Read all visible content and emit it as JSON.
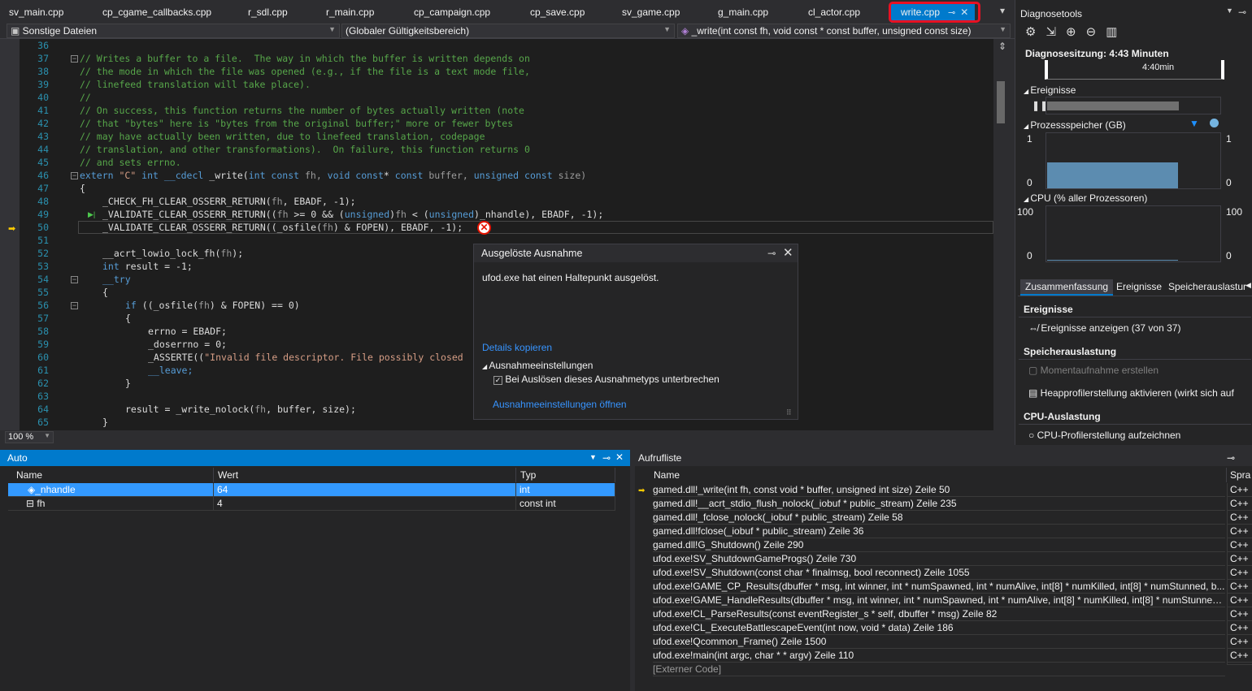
{
  "tabs": [
    "sv_main.cpp",
    "cp_cgame_callbacks.cpp",
    "r_sdl.cpp",
    "r_main.cpp",
    "cp_campaign.cpp",
    "cp_save.cpp",
    "sv_game.cpp",
    "g_main.cpp",
    "cl_actor.cpp"
  ],
  "active_tab": "write.cpp",
  "nav": {
    "project": "Sonstige Dateien",
    "scope": "(Globaler Gültigkeitsbereich)",
    "member": "_write(int const fh, void const * const buffer, unsigned const size)"
  },
  "zoom": "100 %",
  "code": {
    "lines": [
      "36",
      "37",
      "38",
      "39",
      "40",
      "41",
      "42",
      "43",
      "44",
      "45",
      "46",
      "47",
      "48",
      "49",
      "50",
      "51",
      "52",
      "53",
      "54",
      "55",
      "56",
      "57",
      "58",
      "59",
      "60",
      "61",
      "62",
      "63",
      "64",
      "65"
    ],
    "l37": "// Writes a buffer to a file.  The way in which the buffer is written depends on",
    "l38": "// the mode in which the file was opened (e.g., if the file is a text mode file,",
    "l39": "// linefeed translation will take place).",
    "l40": "//",
    "l41": "// On success, this function returns the number of bytes actually written (note",
    "l42": "// that \"bytes\" here is \"bytes from the original buffer;\" more or fewer bytes",
    "l43": "// may have actually been written, due to linefeed translation, codepage",
    "l44": "// translation, and other transformations).  On failure, this function returns 0",
    "l45": "// and sets errno.",
    "l46a": "extern",
    "l46b": " \"C\" ",
    "l46c": "int __cdecl",
    "l46d": " _write(",
    "l46e": "int const",
    " l46f": "",
    "l46g": " fh, ",
    "l46h": "void const",
    "l46i": "* ",
    "l46j": "const",
    "l46k": " buffer, ",
    "l46l": "unsigned const",
    "l46m": " size)",
    "l47": "{",
    "l48a": "_CHECK_FH_CLEAR_OSSERR_RETURN(",
    "l48b": "fh",
    ", l48c": "",
    "l48d": ", EBADF, -1);",
    "l49a": "_VALIDATE_CLEAR_OSSERR_RETURN((",
    "l49b": "fh",
    "l49c": " >= 0 && (",
    "l49d": "unsigned",
    "l49e": ")",
    "l49f": "fh",
    "l49g": " < (",
    "l49h": "unsigned",
    "l49i": ")_nhandle), EBADF, -1);",
    "l50a": "_VALIDATE_CLEAR_OSSERR_RETURN((_osfile(",
    "l50b": "fh",
    "l50c": ") & FOPEN), EBADF, -1);",
    "l52a": "__acrt_lowio_lock_fh(",
    "l52b": "fh",
    "l52c": ");",
    "l53a": "int",
    "l53b": " result = -1;",
    "l54": "__try",
    "l55": "{",
    "l56a": "if",
    "l56b": " ((_osfile(",
    "l56c": "fh",
    "l56d": ") & FOPEN) == 0)",
    "l57": "{",
    "l58": "errno = EBADF;",
    "l59": "_doserrno = 0;",
    "l60a": "_ASSERTE((",
    "l60b": "\"Invalid file descriptor. File possibly closed",
    "l61": "__leave;",
    "l62": "}",
    "l64a": "result = _write_nolock(",
    "l64b": "fh",
    ", l64c": "",
    "l64d": ", buffer, size);",
    "l65": "}"
  },
  "popup": {
    "title": "Ausgelöste Ausnahme",
    "message": "ufod.exe hat einen Haltepunkt ausgelöst.",
    "copy": "Details kopieren",
    "settings": "Ausnahmeeinstellungen",
    "checkbox": "Bei Auslösen dieses Ausnahmetyps unterbrechen",
    "open": "Ausnahmeeinstellungen öffnen"
  },
  "diag": {
    "title": "Diagnosetools",
    "session": "Diagnosesitzung: 4:43 Minuten",
    "time": "4:40min",
    "events": "Ereignisse",
    "memory": "Prozessspeicher (GB)",
    "mem_max": "1",
    "mem_min": "0",
    "cpu": "CPU (% aller Prozessoren)",
    "cpu_max": "100",
    "cpu_min": "0",
    "tabs": [
      "Zusammenfassung",
      "Ereignisse",
      "Speicherauslastur"
    ],
    "sec_events": "Ereignisse",
    "show_events": "Ereignisse anzeigen (37 von 37)",
    "sec_mem": "Speicherauslastung",
    "snapshot": "Momentaufnahme erstellen",
    "heap": "Heapprofilerstellung aktivieren (wirkt sich auf",
    "sec_cpu": "CPU-Auslastung",
    "cpu_rec": "CPU-Profilerstellung aufzeichnen",
    "memory_fill": 0.75
  },
  "auto": {
    "title": "Auto",
    "cols": [
      "Name",
      "Wert",
      "Typ"
    ],
    "rows": [
      {
        "name": "_nhandle",
        "value": "64",
        "type": "int"
      },
      {
        "name": "fh",
        "value": "4",
        "type": "const int"
      }
    ]
  },
  "callstack": {
    "title": "Aufrufliste",
    "cols": [
      "Name",
      "Spra"
    ],
    "rows": [
      {
        "name": "gamed.dll!_write(int fh, const void * buffer, unsigned int size) Zeile 50",
        "lang": "C++"
      },
      {
        "name": "gamed.dll!__acrt_stdio_flush_nolock(_iobuf * public_stream) Zeile 235",
        "lang": "C++"
      },
      {
        "name": "gamed.dll!_fclose_nolock(_iobuf * public_stream) Zeile 58",
        "lang": "C++"
      },
      {
        "name": "gamed.dll!fclose(_iobuf * public_stream) Zeile 36",
        "lang": "C++"
      },
      {
        "name": "gamed.dll!G_Shutdown() Zeile 290",
        "lang": "C++"
      },
      {
        "name": "ufod.exe!SV_ShutdownGameProgs() Zeile 730",
        "lang": "C++"
      },
      {
        "name": "ufod.exe!SV_Shutdown(const char * finalmsg, bool reconnect) Zeile 1055",
        "lang": "C++"
      },
      {
        "name": "ufod.exe!GAME_CP_Results(dbuffer * msg, int winner, int * numSpawned, int * numAlive, int[8] * numKilled, int[8] * numStunned, b...",
        "lang": "C++"
      },
      {
        "name": "ufod.exe!GAME_HandleResults(dbuffer * msg, int winner, int * numSpawned, int * numAlive, int[8] * numKilled, int[8] * numStunned...",
        "lang": "C++"
      },
      {
        "name": "ufod.exe!CL_ParseResults(const eventRegister_s * self, dbuffer * msg) Zeile 82",
        "lang": "C++"
      },
      {
        "name": "ufod.exe!CL_ExecuteBattlescapeEvent(int now, void * data) Zeile 186",
        "lang": "C++"
      },
      {
        "name": "ufod.exe!Qcommon_Frame() Zeile 1500",
        "lang": "C++"
      },
      {
        "name": "ufod.exe!main(int argc, char * * argv) Zeile 110",
        "lang": "C++"
      },
      {
        "name": "[Externer Code]",
        "lang": ""
      }
    ]
  }
}
